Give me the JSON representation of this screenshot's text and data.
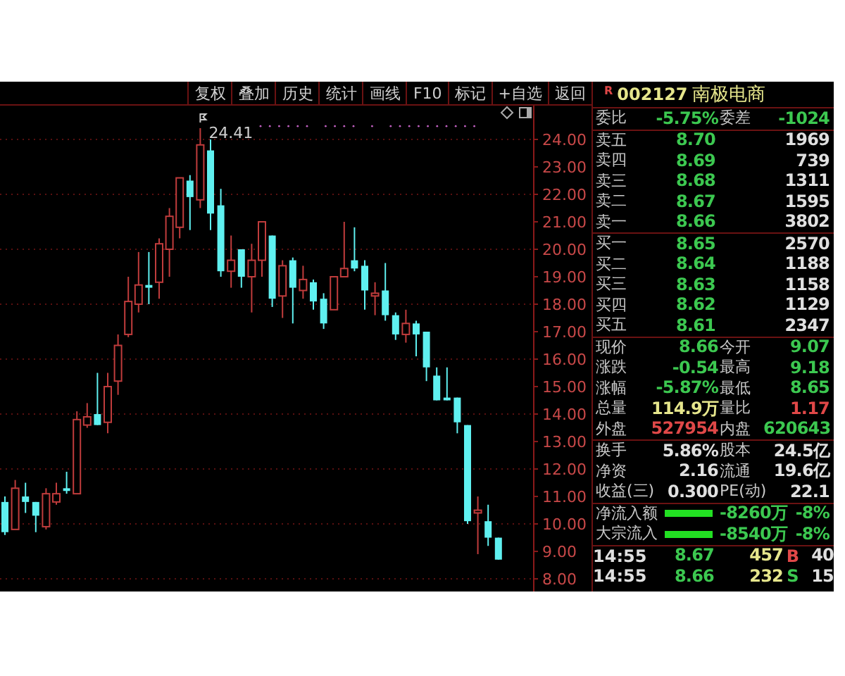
{
  "toolbar": {
    "buttons": [
      "复权",
      "叠加",
      "历史",
      "统计",
      "画线",
      "F10",
      "标记",
      "+自选",
      "返回"
    ]
  },
  "chart": {
    "high_marker": "24.41",
    "chart_data": {
      "type": "candlestick",
      "grid": true,
      "ohlc": [
        [
          10.8,
          11.0,
          9.6,
          9.7
        ],
        [
          9.8,
          11.6,
          9.8,
          11.3
        ],
        [
          11.0,
          11.5,
          10.4,
          10.8
        ],
        [
          10.8,
          10.8,
          9.7,
          10.3
        ],
        [
          9.9,
          11.3,
          9.8,
          11.1
        ],
        [
          10.8,
          11.5,
          10.7,
          11.1
        ],
        [
          11.3,
          11.9,
          11.1,
          11.2
        ],
        [
          11.1,
          14.1,
          11.1,
          13.8
        ],
        [
          13.6,
          14.4,
          13.5,
          13.9
        ],
        [
          14.0,
          15.5,
          13.6,
          13.6
        ],
        [
          13.7,
          15.5,
          13.3,
          15.0
        ],
        [
          15.2,
          16.9,
          14.7,
          16.5
        ],
        [
          16.9,
          19.0,
          16.8,
          18.1
        ],
        [
          18.0,
          19.9,
          17.7,
          18.7
        ],
        [
          18.7,
          19.9,
          18.0,
          18.6
        ],
        [
          18.8,
          20.4,
          18.2,
          20.2
        ],
        [
          20.0,
          21.5,
          19.0,
          21.2
        ],
        [
          20.8,
          22.6,
          20.4,
          22.6
        ],
        [
          22.5,
          22.7,
          20.7,
          21.9
        ],
        [
          21.8,
          24.41,
          21.5,
          23.8
        ],
        [
          23.6,
          24.0,
          20.7,
          21.3
        ],
        [
          21.6,
          22.2,
          19.0,
          19.2
        ],
        [
          19.2,
          20.5,
          18.6,
          19.6
        ],
        [
          20.0,
          20.0,
          18.6,
          19.0
        ],
        [
          19.0,
          20.2,
          17.7,
          19.6
        ],
        [
          19.6,
          21.0,
          19.0,
          21.0
        ],
        [
          20.5,
          20.5,
          17.9,
          18.2
        ],
        [
          18.3,
          19.6,
          17.5,
          19.4
        ],
        [
          19.6,
          19.7,
          17.3,
          18.6
        ],
        [
          18.5,
          19.4,
          18.2,
          18.9
        ],
        [
          18.8,
          18.9,
          17.8,
          18.1
        ],
        [
          18.2,
          18.4,
          17.1,
          17.3
        ],
        [
          17.8,
          19.0,
          17.8,
          19.0
        ],
        [
          19.0,
          21.0,
          19.0,
          19.3
        ],
        [
          19.6,
          20.8,
          19.2,
          19.3
        ],
        [
          19.4,
          19.6,
          17.8,
          18.5
        ],
        [
          18.3,
          18.8,
          17.6,
          18.4
        ],
        [
          18.5,
          19.5,
          17.4,
          17.6
        ],
        [
          17.6,
          17.7,
          16.7,
          16.9
        ],
        [
          16.9,
          17.8,
          16.6,
          17.3
        ],
        [
          17.3,
          17.4,
          16.1,
          16.9
        ],
        [
          17.0,
          17.0,
          15.2,
          15.7
        ],
        [
          15.4,
          15.7,
          14.5,
          14.5
        ],
        [
          14.6,
          15.7,
          14.5,
          14.5
        ],
        [
          14.6,
          14.6,
          13.3,
          13.7
        ],
        [
          13.6,
          13.6,
          10.0,
          10.1
        ],
        [
          10.4,
          11.0,
          8.9,
          10.5
        ],
        [
          10.1,
          10.7,
          9.2,
          9.5
        ],
        [
          9.5,
          9.5,
          8.7,
          8.7
        ]
      ],
      "ylim": [
        7.54,
        25.23
      ],
      "yticks": [
        {
          "value": 24,
          "label": "24.00"
        },
        {
          "value": 23,
          "label": "23.00"
        },
        {
          "value": 22,
          "label": "22.00"
        },
        {
          "value": 21,
          "label": "21.00"
        },
        {
          "value": 20,
          "label": "20.00"
        },
        {
          "value": 19,
          "label": "19.00"
        },
        {
          "value": 18,
          "label": "18.00"
        },
        {
          "value": 17,
          "label": "17.00"
        },
        {
          "value": 16,
          "label": "16.00"
        },
        {
          "value": 15,
          "label": "15.00"
        },
        {
          "value": 14,
          "label": "14.00"
        },
        {
          "value": 13,
          "label": "13.00"
        },
        {
          "value": 12,
          "label": "12.00"
        },
        {
          "value": 11,
          "label": "11.00"
        },
        {
          "value": 10,
          "label": "10.00"
        },
        {
          "value": 9,
          "label": "9.00"
        },
        {
          "value": 8,
          "label": "8.00"
        }
      ]
    }
  },
  "quote": {
    "flag": "R",
    "code": "002127",
    "name": "南极电商"
  },
  "order_imbalance": [
    {
      "label": "委比",
      "value": "-5.75%",
      "color": "#3cc850"
    },
    {
      "label": "委差",
      "value": "-1024",
      "color": "#3cc850"
    }
  ],
  "asks": [
    {
      "label": "卖五",
      "price": "8.70",
      "volume": "1969"
    },
    {
      "label": "卖四",
      "price": "8.69",
      "volume": "739"
    },
    {
      "label": "卖三",
      "price": "8.68",
      "volume": "1311"
    },
    {
      "label": "卖二",
      "price": "8.67",
      "volume": "1595"
    },
    {
      "label": "卖一",
      "price": "8.66",
      "volume": "3802"
    }
  ],
  "bids": [
    {
      "label": "买一",
      "price": "8.65",
      "volume": "2570"
    },
    {
      "label": "买二",
      "price": "8.64",
      "volume": "1188"
    },
    {
      "label": "买三",
      "price": "8.63",
      "volume": "1158"
    },
    {
      "label": "买四",
      "price": "8.62",
      "volume": "1129"
    },
    {
      "label": "买五",
      "price": "8.61",
      "volume": "2347"
    }
  ],
  "quote_stats": [
    {
      "label": "现价",
      "value": "8.66",
      "color": "#3cc850"
    },
    {
      "label": "今开",
      "value": "9.07",
      "color": "#3cc850"
    },
    {
      "label": "涨跌",
      "value": "-0.54",
      "color": "#3cc850"
    },
    {
      "label": "最高",
      "value": "9.18",
      "color": "#3cc850"
    },
    {
      "label": "涨幅",
      "value": "-5.87%",
      "color": "#3cc850"
    },
    {
      "label": "最低",
      "value": "8.65",
      "color": "#3cc850"
    },
    {
      "label": "总量",
      "value": "114.9万",
      "color": "#e6e68c"
    },
    {
      "label": "量比",
      "value": "1.17",
      "color": "#e04848"
    },
    {
      "label": "外盘",
      "value": "527954",
      "color": "#e04848"
    },
    {
      "label": "内盘",
      "value": "620643",
      "color": "#3cc850"
    }
  ],
  "share_stats": [
    {
      "label": "换手",
      "value": "5.86%",
      "color": "#e0e0e0"
    },
    {
      "label": "股本",
      "value": "24.5亿",
      "color": "#e0e0e0"
    },
    {
      "label": "净资",
      "value": "2.16",
      "color": "#e0e0e0"
    },
    {
      "label": "流通",
      "value": "19.6亿",
      "color": "#e0e0e0"
    },
    {
      "label": "收益(三)",
      "value": "0.300",
      "color": "#e0e0e0"
    },
    {
      "label": "PE(动)",
      "value": "22.1",
      "color": "#e0e0e0"
    }
  ],
  "fund_flows": [
    {
      "label": "净流入额",
      "amount": "-8260万",
      "percent": "-8%"
    },
    {
      "label": "大宗流入",
      "amount": "-8540万",
      "percent": "-8%"
    }
  ],
  "trades": [
    {
      "time": "14:55",
      "price": "8.67",
      "volume": "457",
      "side": "B",
      "color": "#e04848",
      "count": "40"
    },
    {
      "time": "14:55",
      "price": "8.66",
      "volume": "232",
      "side": "S",
      "color": "#3cc850",
      "count": "15"
    }
  ]
}
